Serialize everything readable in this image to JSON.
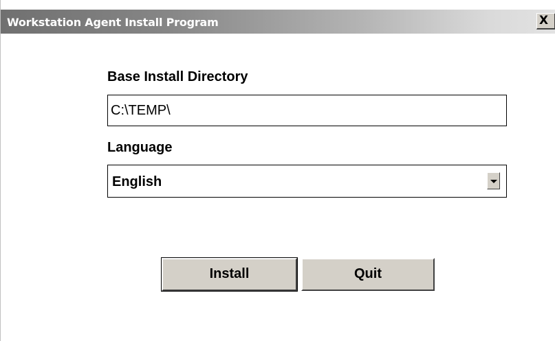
{
  "window": {
    "title": "Workstation Agent Install Program",
    "close_glyph": "X"
  },
  "form": {
    "directory_label": "Base Install Directory",
    "directory_value": "C:\\TEMP\\",
    "language_label": "Language",
    "language_selected": "English"
  },
  "buttons": {
    "install_label": "Install",
    "quit_label": "Quit"
  },
  "icons": {
    "close": "close-icon",
    "dropdown": "chevron-down-icon"
  },
  "colors": {
    "titlebar_start": "#707070",
    "titlebar_end": "#e2e2e2",
    "button_face": "#d4d0c8"
  }
}
